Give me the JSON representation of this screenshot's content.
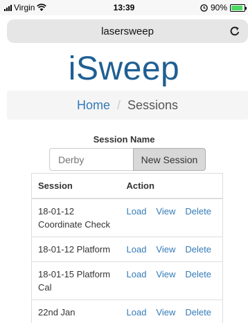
{
  "status_bar": {
    "carrier": "Virgin",
    "time": "13:39",
    "battery": "90%",
    "battery_level": 0.9,
    "battery_color": "#4cd964",
    "icons": [
      "signal-icon",
      "wifi-icon",
      "alarm-icon",
      "battery-icon"
    ]
  },
  "browser": {
    "url": "lasersweep",
    "reload_icon": "reload-icon"
  },
  "logo": "iSweep",
  "breadcrumb": {
    "home": "Home",
    "separator": "/",
    "current": "Sessions"
  },
  "form": {
    "label": "Session Name",
    "input_placeholder": "Derby",
    "button": "New Session"
  },
  "table": {
    "headers": [
      "Session",
      "Action"
    ],
    "rows": [
      {
        "session": "18-01-12 Coordinate Check",
        "actions": [
          "Load",
          "View",
          "Delete"
        ]
      },
      {
        "session": "18-01-12 Platform",
        "actions": [
          "Load",
          "View",
          "Delete"
        ]
      },
      {
        "session": "18-01-15 Platform Cal",
        "actions": [
          "Load",
          "View",
          "Delete"
        ]
      },
      {
        "session": "22nd Jan",
        "actions": [
          "Load",
          "View",
          "Delete"
        ]
      }
    ]
  },
  "colors": {
    "brand": "#1f5f92",
    "link": "#337ab7"
  }
}
